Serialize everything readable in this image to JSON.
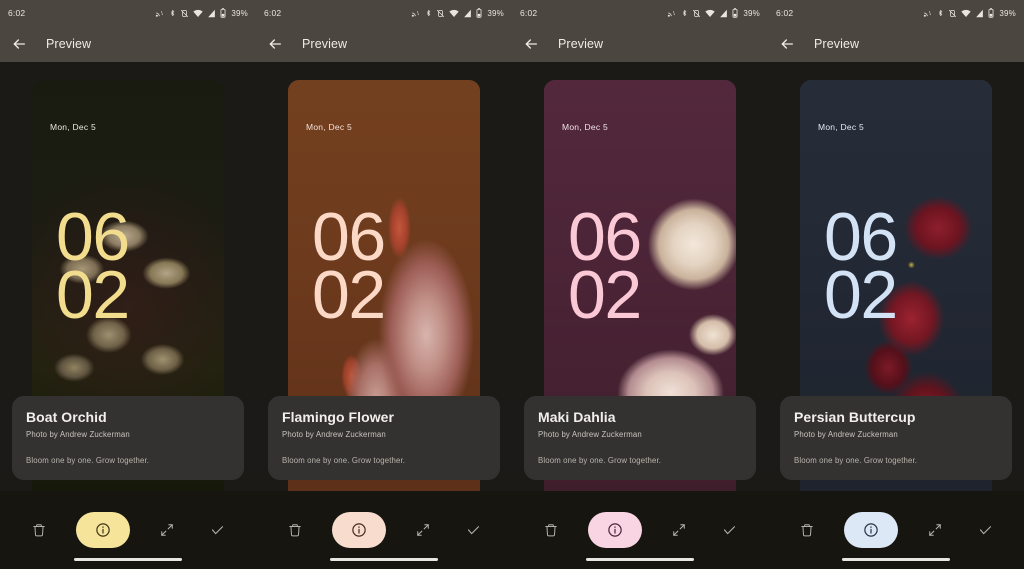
{
  "statusbar": {
    "time": "6:02",
    "battery_percent": "39%",
    "icons": [
      "cast-icon",
      "bluetooth-icon",
      "vibrate-off-icon",
      "wifi-icon",
      "signal-icon",
      "battery-icon"
    ]
  },
  "appbar": {
    "title": "Preview",
    "back_icon": "arrow-back-icon"
  },
  "lockscreen": {
    "date": "Mon, Dec 5",
    "hour": "06",
    "minute": "02"
  },
  "toolbar": {
    "delete_icon": "trash-icon",
    "info_icon": "info-icon",
    "expand_icon": "fullscreen-expand-icon",
    "confirm_icon": "check-icon"
  },
  "shared": {
    "author": "Photo by Andrew Zuckerman",
    "description": "Bloom one by one. Grow together."
  },
  "panels": [
    {
      "title": "Boat Orchid",
      "author": "Photo by Andrew Zuckerman",
      "description": "Bloom one by one. Grow together.",
      "wallpaper_bg": "#171a10",
      "clock_color": "#f2dd8e",
      "date_color": "#ece8e0",
      "accent": "#f5e49a",
      "accent_fg": "#3d3416"
    },
    {
      "title": "Flamingo Flower",
      "author": "Photo by Andrew Zuckerman",
      "description": "Bloom one by one. Grow together.",
      "wallpaper_bg": "#6b3a20",
      "clock_color": "#fbd9c6",
      "date_color": "#f3e3da",
      "accent": "#f8ddce",
      "accent_fg": "#45291c"
    },
    {
      "title": "Maki Dahlia",
      "author": "Photo by Andrew Zuckerman",
      "description": "Bloom one by one. Grow together.",
      "wallpaper_bg": "#4a2438",
      "clock_color": "#fbc9d6",
      "date_color": "#f2e2e8",
      "accent": "#f9d4e3",
      "accent_fg": "#4a2334"
    },
    {
      "title": "Persian Buttercup",
      "author": "Photo by Andrew Zuckerman",
      "description": "Bloom one by one. Grow together.",
      "wallpaper_bg": "#232935",
      "clock_color": "#d3e2f5",
      "date_color": "#e4eaf2",
      "accent": "#dce8f6",
      "accent_fg": "#263243"
    }
  ]
}
